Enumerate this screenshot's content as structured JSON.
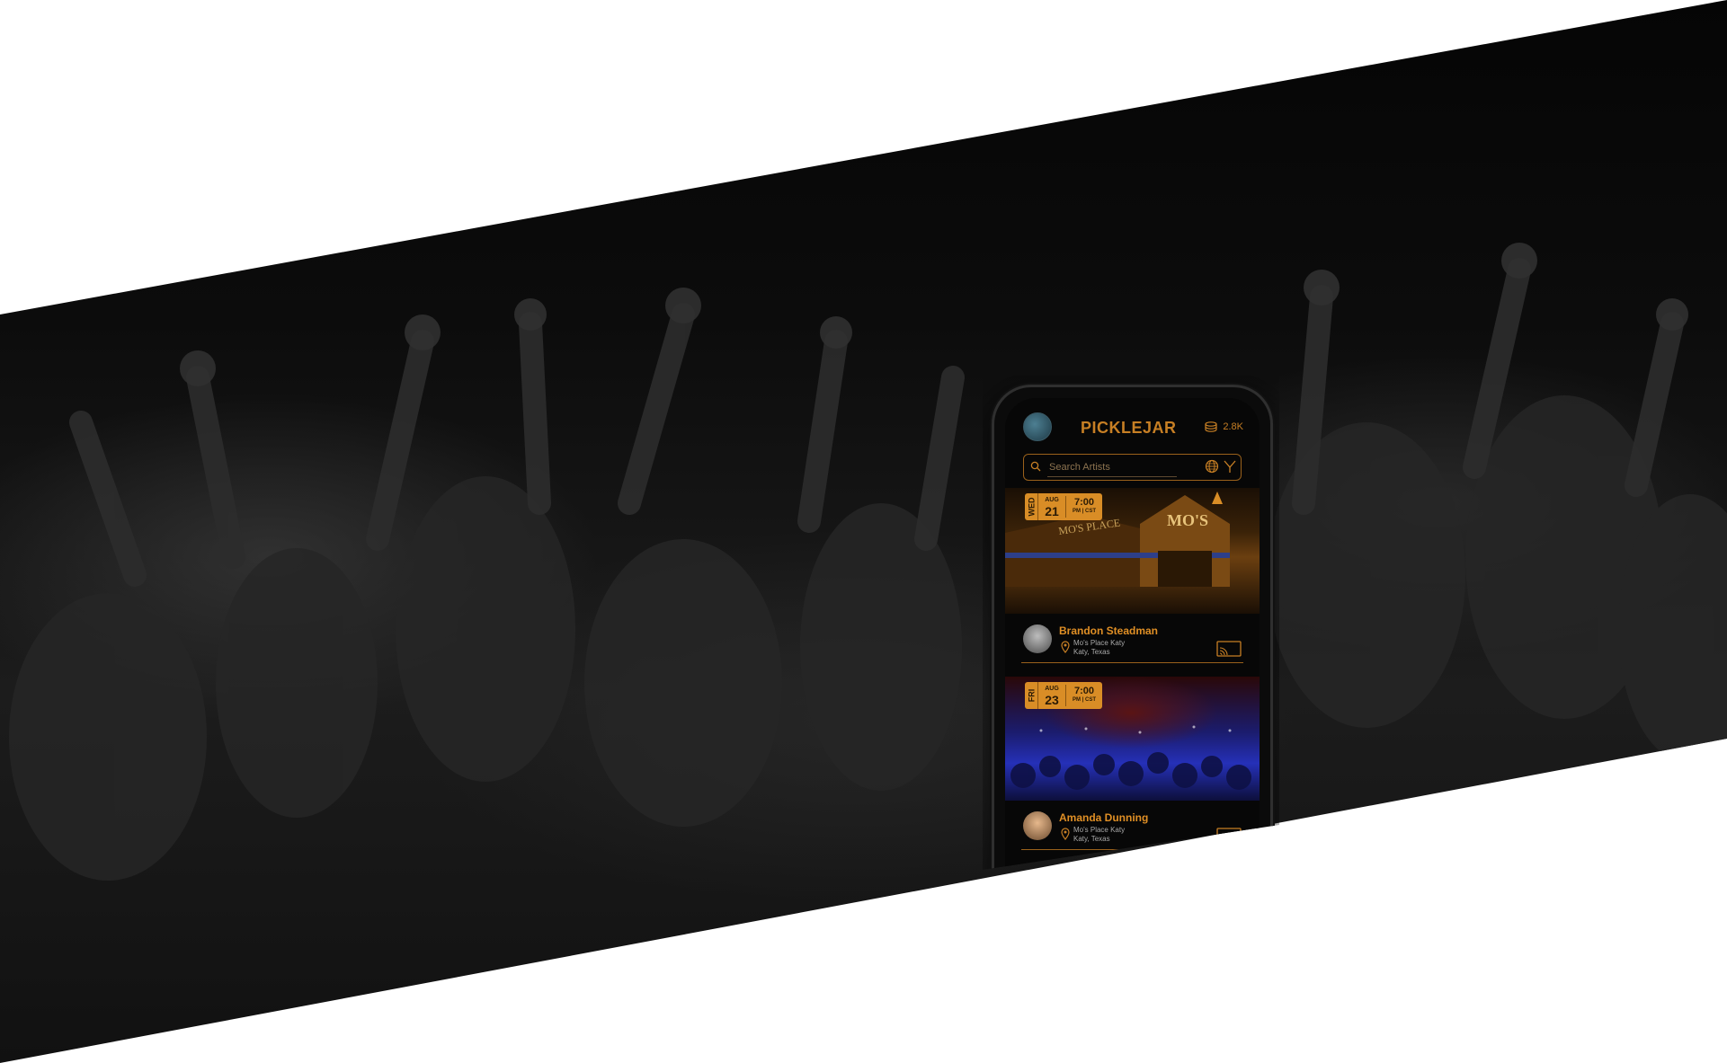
{
  "app": {
    "logo": "PICKLEJAR",
    "coin_count": "2.8K",
    "brand_color": "#c77f24"
  },
  "search": {
    "placeholder": "Search Artists"
  },
  "events": [
    {
      "day_of_week": "WED",
      "month": "AUG",
      "day": "21",
      "time": "7:00",
      "zone": "PM | CST",
      "image_sign": "MO'S",
      "artist": "Brandon Steadman",
      "venue_line1": "Mo's Place Katy",
      "venue_line2": "Katy, Texas"
    },
    {
      "day_of_week": "FRI",
      "month": "AUG",
      "day": "23",
      "time": "7:00",
      "zone": "PM | CST",
      "artist": "Amanda Dunning",
      "venue_line1": "Mo's Place Katy",
      "venue_line2": "Katy, Texas"
    }
  ],
  "icons": [
    "search-icon",
    "globe-icon",
    "filter-icon",
    "coin-stack-icon",
    "location-pin-icon",
    "cast-icon"
  ]
}
